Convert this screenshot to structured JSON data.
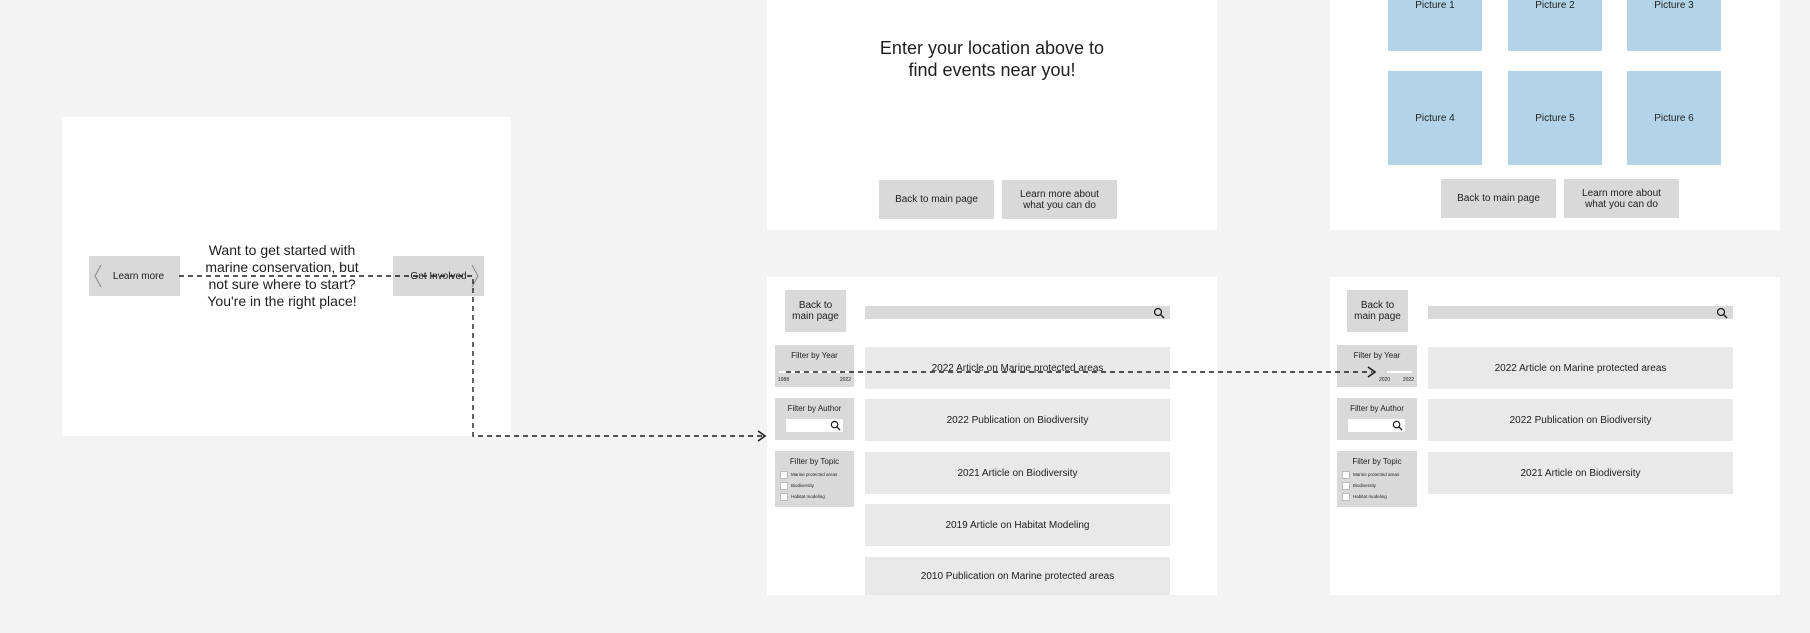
{
  "intro": {
    "learn_more": "Learn more",
    "message": "Want to get started with marine conservation, but not sure where to start? You're in the right place!",
    "get_involved": "Get Involved"
  },
  "events": {
    "message": "Enter your location above to find events near you!",
    "back": "Back to main page",
    "learn_more": "Learn more about what you can do"
  },
  "gallery": {
    "pictures": [
      "Picture 1",
      "Picture 2",
      "Picture 3",
      "Picture 4",
      "Picture 5",
      "Picture 6"
    ],
    "back": "Back to main page",
    "learn_more": "Learn more about what you can do"
  },
  "library": {
    "back": "Back to main page",
    "filter_year": "Filter by Year",
    "year_min": "1988",
    "year_max": "2022",
    "filter_author": "Filter by Author",
    "filter_topic": "Filter by Topic",
    "topics": [
      "Marine protected areas",
      "Biodiversity",
      "Habitat modeling"
    ],
    "items": [
      "2022 Article on Marine protected areas",
      "2022 Publication on Biodiversity",
      "2021 Article on Biodiversity",
      "2019 Article on Habitat Modeling",
      "2010 Publication on Marine protected areas"
    ]
  },
  "library_filtered": {
    "back": "Back to main page",
    "filter_year": "Filter by Year",
    "year_min": "2020",
    "year_max": "2022",
    "filter_author": "Filter by Author",
    "filter_topic": "Filter by Topic",
    "topics": [
      "Marine protected areas",
      "Biodiversity",
      "Habitat modeling"
    ],
    "items": [
      "2022 Article on Marine protected areas",
      "2022 Publication on Biodiversity",
      "2021 Article on Biodiversity"
    ]
  }
}
